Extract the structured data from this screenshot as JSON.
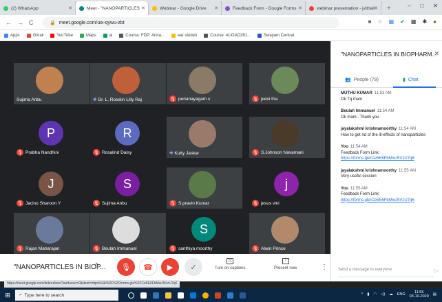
{
  "browser": {
    "tabs": [
      {
        "label": "(2) WhatsApp",
        "color": "#25d366",
        "active": false
      },
      {
        "label": "Meet - \"NANOPARTICLES",
        "color": "#00897b",
        "active": true
      },
      {
        "label": "Webinar - Google Drive",
        "color": "#fbbc04",
        "active": false
      },
      {
        "label": "Feedback Form - Google Forms",
        "color": "#7e57c2",
        "active": false
      },
      {
        "label": "webinar presentation - jvithali",
        "color": "#ea4335",
        "active": false
      }
    ],
    "new_tab": "+",
    "window_controls": [
      "–",
      "□",
      "✕"
    ],
    "url": "meet.google.com/uix-qywu-zbt",
    "bookmarks": [
      "Apps",
      "Gmail",
      "YouTube",
      "Maps",
      "ai",
      "Course: FDP: Anna...",
      "ear studen",
      "Course: AUGAD261...",
      "Swayam Central"
    ]
  },
  "meeting": {
    "title": "\"NANOPARTICLES IN BIOP...",
    "participants": [
      {
        "name": "Sujima Anbu",
        "kind": "photo",
        "muted": false,
        "talking": false,
        "photo_color": "#c08050"
      },
      {
        "name": "Dr. L. Roselin Lilly Raj",
        "kind": "photo",
        "muted": false,
        "talking": true,
        "photo_color": "#c0603a"
      },
      {
        "name": "perianayagam s",
        "kind": "photo",
        "muted": true,
        "talking": false,
        "photo_color": "#8a7a66"
      },
      {
        "name": "jeevi tha",
        "kind": "photo",
        "muted": true,
        "talking": false,
        "photo_color": "#6a8a5a"
      },
      {
        "name": "Prabha Nandhini",
        "kind": "initial",
        "initial": "P",
        "color": "#5e35b1",
        "muted": true,
        "talking": false
      },
      {
        "name": "Rosalind Daisy",
        "kind": "initial",
        "initial": "R",
        "color": "#5c6bc0",
        "muted": true,
        "talking": false
      },
      {
        "name": "Kutty Jaskar",
        "kind": "photo",
        "muted": false,
        "talking": true,
        "photo_color": "#9a7a6a"
      },
      {
        "name": "S.Johnson Navamani",
        "kind": "photo",
        "muted": true,
        "talking": false,
        "photo_color": "#4a3a2a"
      },
      {
        "name": "Jacino Sharoon Y",
        "kind": "initial",
        "initial": "J",
        "color": "#795548",
        "muted": true,
        "talking": false
      },
      {
        "name": "Sujima Anbu",
        "kind": "initial",
        "initial": "S",
        "color": "#7b1fa2",
        "muted": true,
        "talking": false
      },
      {
        "name": "S.pravin Kumar",
        "kind": "photo",
        "muted": true,
        "talking": false,
        "photo_color": "#5a7a4a"
      },
      {
        "name": "jesus vini",
        "kind": "initial",
        "initial": "j",
        "color": "#8e24aa",
        "muted": true,
        "talking": false
      },
      {
        "name": "Rajan Maharajan",
        "kind": "photo",
        "muted": true,
        "talking": false,
        "photo_color": "#6a7a9a"
      },
      {
        "name": "Beulah Immanuel",
        "kind": "photo",
        "muted": true,
        "talking": false,
        "photo_color": "#ddd"
      },
      {
        "name": "santhiya moorthy",
        "kind": "initial",
        "initial": "S",
        "color": "#00897b",
        "muted": true,
        "talking": false
      },
      {
        "name": "Alwin Prince",
        "kind": "photo",
        "muted": true,
        "talking": false,
        "photo_color": "#b08a6a"
      }
    ],
    "controls": {
      "captions": "Turn on captions",
      "present": "Present now",
      "more": "⋮"
    }
  },
  "side_panel": {
    "title": "\"NANOPARTICLES IN BIOPHARM...",
    "people_tab": "People (79)",
    "chat_tab": "Chat",
    "messages": [
      {
        "sender": "MUTHU KUMAR",
        "time": "11:53 AM",
        "text": "Ok Tq mam",
        "link": ""
      },
      {
        "sender": "Beulah Immanuel",
        "time": "11:54 AM",
        "text": "Ok mam.. Thank you",
        "link": ""
      },
      {
        "sender": "jayalakshmi krishnamoorthy",
        "time": "11:54 AM",
        "text": "How to get rid of the ill-effects of nanoparticles",
        "link": ""
      },
      {
        "sender": "You",
        "time": "11:54 AM",
        "text": "Feedback Form Link:",
        "link": "https://forms.gle/Ce5E6FbMwJ5VzU7q6"
      },
      {
        "sender": "jayalakshmi krishnamoorthy",
        "time": "11:55 AM",
        "text": "Very useful session",
        "link": ""
      },
      {
        "sender": "You",
        "time": "11:55 AM",
        "text": "Feedback Form Link:",
        "link": "https://forms.gle/Ce5E6FbMwJ5VzU7q6"
      }
    ],
    "compose_placeholder": "Send a message to everyone"
  },
  "status_url": "https://meet.google.com/linkredirect?authuser=0&dest=https%3A%2F%2Fforms.gle%2FCe5E6FbMwJ5VzU7q6",
  "taskbar": {
    "search": "Type here to search",
    "lang": "ENG",
    "time": "11:55",
    "date": "03-10-2020"
  }
}
